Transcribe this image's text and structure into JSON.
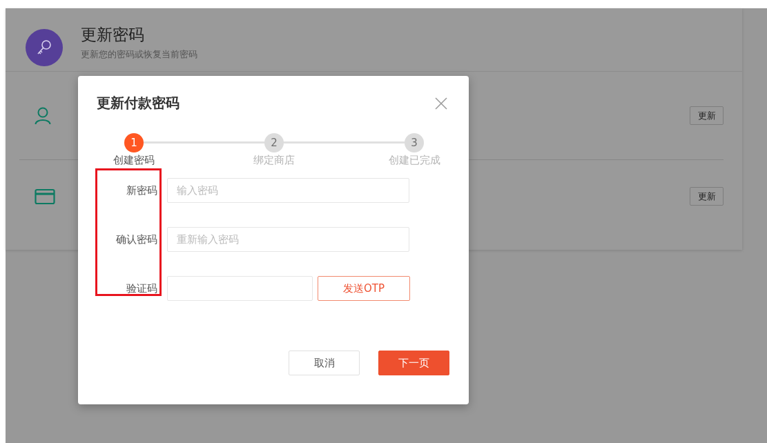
{
  "page": {
    "title": "更新密码",
    "subtitle": "更新您的密码或恢复当前密码",
    "rows": [
      {
        "kind": "user",
        "button": "更新"
      },
      {
        "kind": "card",
        "button": "更新"
      }
    ]
  },
  "dialog": {
    "title": "更新付款密码",
    "steps": [
      {
        "number": "1",
        "label": "创建密码",
        "selected": true
      },
      {
        "number": "2",
        "label": "绑定商店",
        "selected": false
      },
      {
        "number": "3",
        "label": "创建已完成",
        "selected": false
      }
    ],
    "fields": [
      {
        "kind": "text",
        "label": "新密码",
        "placeholder": "输入密码"
      },
      {
        "kind": "text",
        "label": "确认密码",
        "placeholder": "重新输入密码"
      },
      {
        "kind": "otp",
        "label": "验证码",
        "button": "发送OTP"
      }
    ],
    "buttons": [
      {
        "kind": "secondary",
        "label": "取消"
      },
      {
        "kind": "primary",
        "label": "下一页"
      }
    ]
  }
}
